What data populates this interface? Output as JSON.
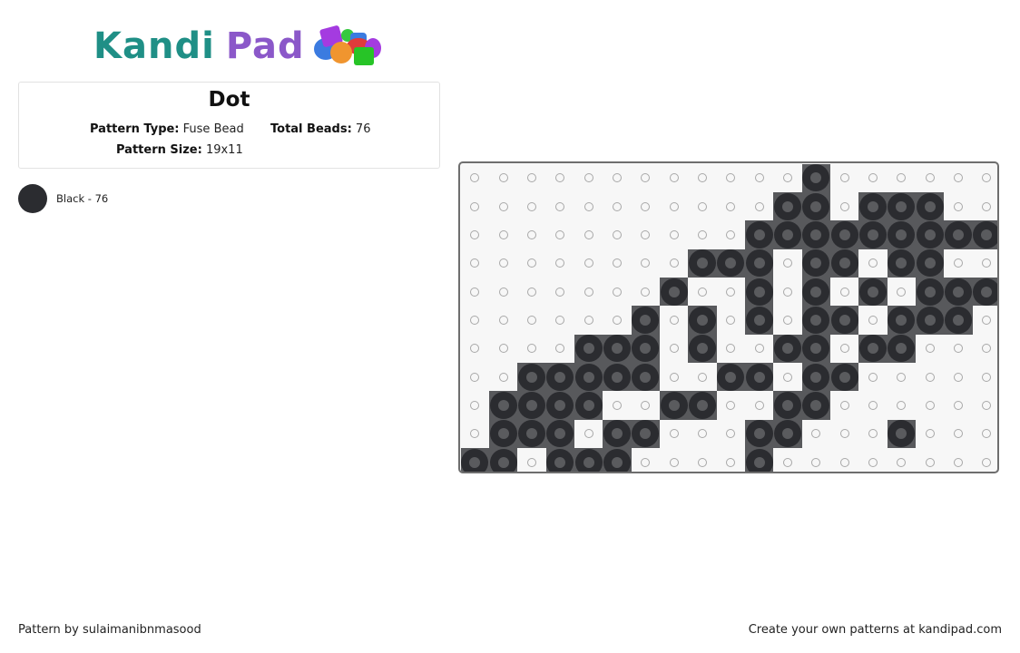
{
  "logo": {
    "part1": "Kandi",
    "part2": "Pad",
    "icon": "bead-pile-icon"
  },
  "pattern": {
    "title": "Dot",
    "type_label": "Pattern Type:",
    "type_value": "Fuse Bead",
    "total_label": "Total Beads:",
    "total_value": "76",
    "size_label": "Pattern Size:",
    "size_value": "19x11"
  },
  "legend": [
    {
      "color": "#2b2c30",
      "label": "Black - 76"
    }
  ],
  "grid": {
    "columns": 19,
    "rows": 11,
    "bead_color": "#2b2c30",
    "cells": [
      "............X......",
      "...........XX.XXX..",
      "..........XXXXXXXXX",
      "........XXX.XX.XX..",
      ".......X..X.X.X.XXX",
      "......X.X.X.XX.XXX.",
      "....XXX.X..XX.XX...",
      "..XXXXX..XX.XX.....",
      ".XXXX..XX..XX......",
      ".XXX.XX...XX...X...",
      "XX.XXX....X........"
    ]
  },
  "footer": {
    "author": "Pattern by sulaimanibnmasood",
    "cta": "Create your own patterns at kandipad.com"
  }
}
